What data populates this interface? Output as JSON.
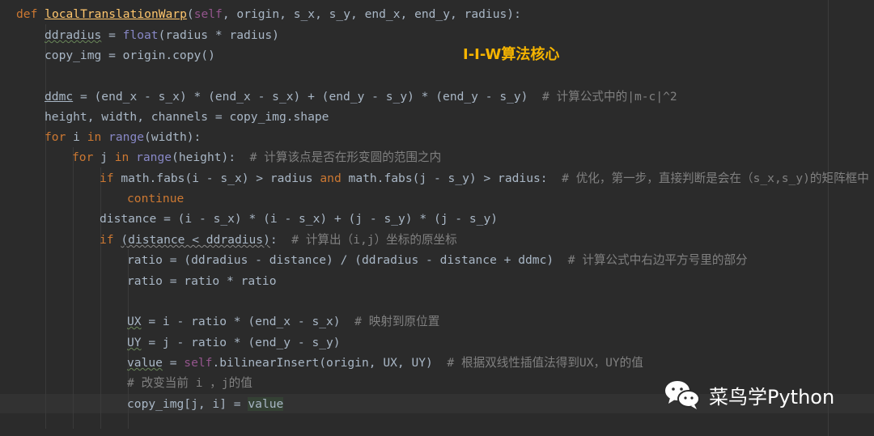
{
  "annotation": "I-I-W算法核心",
  "brand": {
    "name": "菜鸟学Python",
    "icon": "wechat-icon"
  },
  "code": {
    "l1": {
      "def": "def",
      "fname": "localTranslationWarp",
      "open": "(",
      "self": "self",
      "args": ", origin, s_x, s_y, end_x, end_y, radius):"
    },
    "l2": {
      "var": "ddradius",
      "eq": " = ",
      "fn": "float",
      "rest": "(radius * radius)"
    },
    "l3": {
      "text": "copy_img = origin.copy()"
    },
    "l4": {
      "var": "ddmc",
      "rest": " = (end_x - s_x) * (end_x - s_x) + (end_y - s_y) * (end_y - s_y)",
      "comment": "  # 计算公式中的|m-c|^2"
    },
    "l5": {
      "text": "height, width, channels = copy_img.shape"
    },
    "l6": {
      "kw1": "for",
      "mid": " i ",
      "kw2": "in",
      "sp": " ",
      "fn": "range",
      "rest": "(width):"
    },
    "l7": {
      "kw1": "for",
      "mid": " j ",
      "kw2": "in",
      "sp": " ",
      "fn": "range",
      "rest": "(height):",
      "comment": "  # 计算该点是否在形变圆的范围之内"
    },
    "l8": {
      "kw1": "if",
      "a": " math.fabs(i - s_x) > radius ",
      "kw2": "and",
      "b": " math.fabs(j - s_y) > radius:",
      "comment": "  # 优化，第一步，直接判断是会在（s_x,s_y)的矩阵框中"
    },
    "l9": {
      "kw": "continue"
    },
    "l10": {
      "text": "distance = (i - s_x) * (i - s_x) + (j - s_y) * (j - s_y)"
    },
    "l11": {
      "kw": "if",
      "sp": " ",
      "cond": "(distance < ddradius)",
      "colon": ":",
      "comment": "  # 计算出（i,j）坐标的原坐标"
    },
    "l12": {
      "text": "ratio = (ddradius - distance) / (ddradius - distance + ddmc)",
      "comment": "  # 计算公式中右边平方号里的部分"
    },
    "l13": {
      "text": "ratio = ratio * ratio"
    },
    "l14": {
      "var": "UX",
      "rest": " = i - ratio * (end_x - s_x)",
      "comment": "  # 映射到原位置"
    },
    "l15": {
      "var": "UY",
      "rest": " = j - ratio * (end_y - s_y)"
    },
    "l16": {
      "var": "value",
      "eq": " = ",
      "self": "self",
      "rest": ".bilinearInsert(origin, UX, UY)",
      "comment": "  # 根据双线性插值法得到UX，UY的值"
    },
    "l17": {
      "comment": "# 改变当前 i ，j的值"
    },
    "l18": {
      "pre": "copy_img[j, i] = ",
      "val": "value"
    }
  }
}
